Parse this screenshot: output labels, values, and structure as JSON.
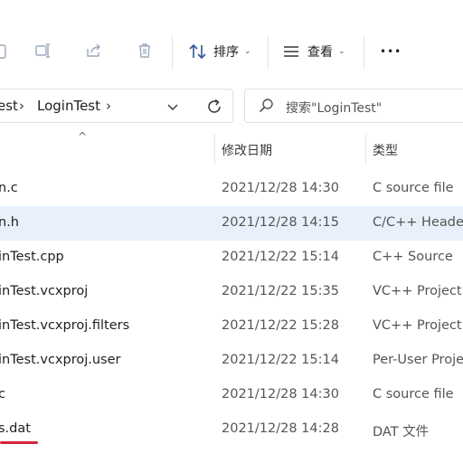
{
  "toolbar": {
    "sort_label": "排序",
    "view_label": "查看",
    "more_label": "•••"
  },
  "address": {
    "crumbs": [
      "est",
      "LoginTest"
    ],
    "separator": "›"
  },
  "search": {
    "placeholder": "搜索\"LoginTest\""
  },
  "columns": {
    "date": "修改日期",
    "type": "类型"
  },
  "files": [
    {
      "name": "n.c",
      "date": "2021/12/28 14:30",
      "type": "C source file"
    },
    {
      "name": "n.h",
      "date": "2021/12/28 14:15",
      "type": "C/C++ Header"
    },
    {
      "name": "inTest.cpp",
      "date": "2021/12/22 15:14",
      "type": "C++ Source"
    },
    {
      "name": "inTest.vcxproj",
      "date": "2021/12/22 15:35",
      "type": "VC++ Project"
    },
    {
      "name": "inTest.vcxproj.filters",
      "date": "2021/12/22 15:28",
      "type": "VC++ Project F"
    },
    {
      "name": "inTest.vcxproj.user",
      "date": "2021/12/22 15:14",
      "type": "Per-User Projec"
    },
    {
      "name": "c",
      "date": "2021/12/28 14:30",
      "type": "C source file"
    },
    {
      "name": "s.dat",
      "date": "2021/12/28 14:28",
      "type": "DAT 文件"
    }
  ],
  "selected_row": 1,
  "colors": {
    "selection": "#e8f1fb",
    "annotation": "#d6243a"
  }
}
